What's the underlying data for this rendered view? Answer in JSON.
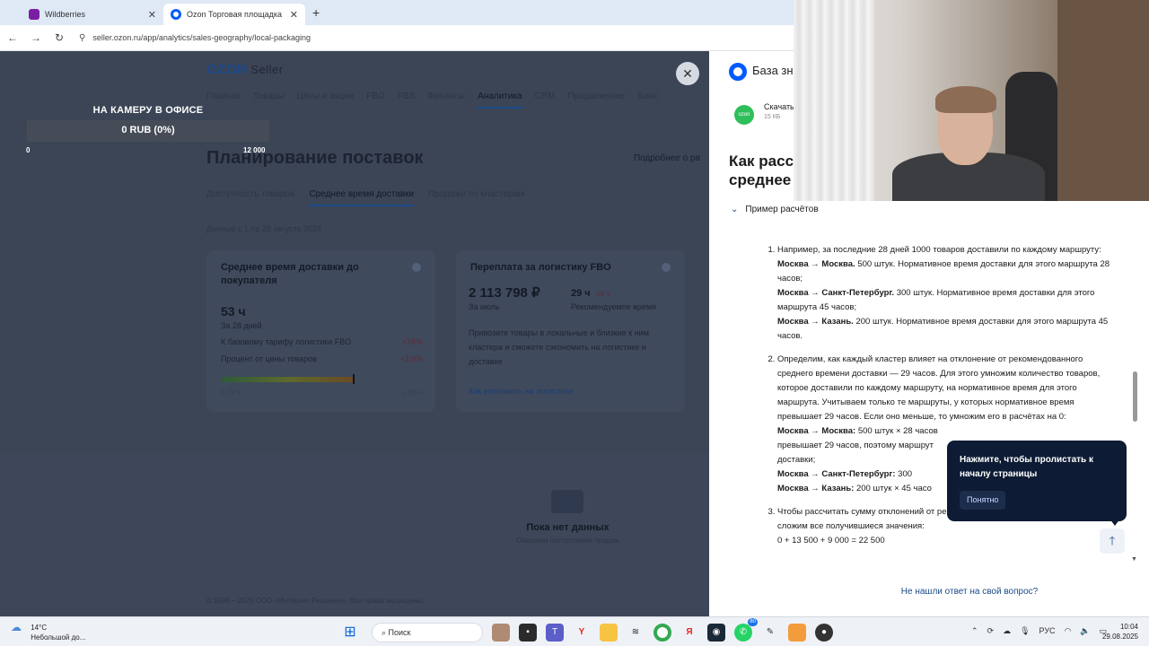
{
  "browser": {
    "tabs": [
      {
        "label": "Wildberries",
        "favicon_color": "#7a1fa2",
        "active": false
      },
      {
        "label": "Ozon Торговая площадка",
        "favicon_color": "#005bff",
        "active": true
      }
    ],
    "url": "seller.ozon.ru/app/analytics/sales-geography/local-packaging"
  },
  "ozon": {
    "logo": "OZON",
    "logo_suffix": "Seller",
    "nav": [
      "Главная",
      "Товары",
      "Цены и акции",
      "FBO",
      "FBS",
      "Финансы",
      "Аналитика",
      "CRM",
      "Продвижение",
      "Банк"
    ],
    "nav_active": "Аналитика",
    "page_title": "Планирование поставок",
    "more_link": "Подробнее о ра",
    "subtabs": [
      "Доступность товаров",
      "Среднее время доставки",
      "Продажи по кластерам"
    ],
    "subtab_active": "Среднее время доставки",
    "data_note": "Данные с 1 по 28 августа 2024",
    "card1": {
      "title": "Среднее время доставки до покупателя",
      "value": "53 ч",
      "sub": "За 28 дней",
      "row1_label": "К базовому тарифу логистики FBO",
      "row1_value": "+78%",
      "row2_label": "Процент от цены товаров",
      "row2_value": "+3,9%",
      "progress_fraction": 0.66,
      "bar_min": "0-29 ч",
      "bar_max": "≥ 60 ч"
    },
    "card2": {
      "title": "Переплата за логистику FBO",
      "value": "2 113 798 ₽",
      "value_sub": "За июль",
      "time_value": "29 ч",
      "time_delta": "-24 ч",
      "time_sub": "Рекомендуемое время",
      "description": "Привозите товары в локальные и близкие к ним кластера и сможете сэкономить на логистике и доставке",
      "link": "Как экономить на логистике"
    },
    "empty_title": "Пока нет данных",
    "empty_sub": "Ожидаем поступления продаж",
    "footer": "© 1998 – 2025 ООО «Интернет Решения». Все права защищены."
  },
  "stream_overlay": {
    "title": "НА КАМЕРУ В ОФИСЕ",
    "amount": "0 RUB (0%)",
    "min": "0",
    "max": "12 000"
  },
  "help_panel": {
    "brand": "База зн",
    "app_title": "Скачать",
    "app_size": "15 КБ",
    "heading_line1": "Как расс",
    "heading_line2": "среднее",
    "toggle": "Пример расчётов",
    "item1": {
      "intro": "Например, за последние 28 дней 1000 товаров доставили по каждому маршруту:",
      "r1_bold": "Москва → Москва.",
      "r1_text": "500 штук. Нормативное время доставки для этого маршрута 28 часов;",
      "r2_bold": "Москва → Санкт-Петербург.",
      "r2_text": "300 штук. Нормативное время доставки для этого маршрута 45 часов;",
      "r3_bold": "Москва → Казань.",
      "r3_text": "200 штук. Нормативное время доставки для этого маршрута 45 часов."
    },
    "item2": {
      "intro": "Определим, как каждый кластер влияет на отклонение от рекомендованного среднего времени доставки — 29 часов. Для этого умножим количество товаров, которое доставили по каждому маршруту, на нормативное время для этого маршрута. Учитываем только те маршруты, у которых нормативное время превышает 29 часов. Если оно меньше, то умножим его в расчётах на 0:",
      "r1_bold": "Москва → Москва:",
      "r1_text": "500 штук × 28 часов",
      "r1_cont": "превышает 29 часов, поэтому маршрут",
      "r1_cont2": "доставки;",
      "r2_bold": "Москва → Санкт-Петербург:",
      "r2_text": "300",
      "r3_bold": "Москва → Казань:",
      "r3_text": "200 штук × 45 часо"
    },
    "item3": {
      "intro": "Чтобы рассчитать сумму отклонений от рекомендованного среднего времени, сложим все получившиеся значения:",
      "formula": "0 + 13 500 + 9 000 = 22 500"
    },
    "footer_link": "Не нашли ответ на свой вопрос?",
    "tooltip_text": "Нажмите, чтобы пролистать к началу страницы",
    "tooltip_button": "Понятно"
  },
  "taskbar": {
    "temp": "14°C",
    "weather": "Небольшой до...",
    "search": "Поиск",
    "lang": "РУС",
    "time": "10:04",
    "date": "29.08.2025",
    "badge": "80"
  }
}
